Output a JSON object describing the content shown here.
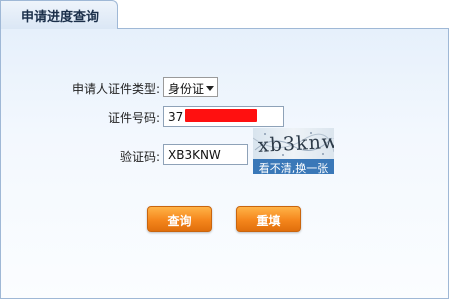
{
  "tab": {
    "title": "申请进度查询"
  },
  "form": {
    "id_type_label": "申请人证件类型:",
    "id_type_value": "身份证",
    "id_number_label": "证件号码:",
    "id_number_value": "37",
    "captcha_label": "验证码:",
    "captcha_value": "XB3KNW",
    "captcha_image_text": "xb3knw",
    "captcha_refresh": "看不清,换一张"
  },
  "buttons": {
    "query": "查询",
    "reset": "重填"
  },
  "colors": {
    "button_orange": "#f5861c",
    "redaction": "#ff1010",
    "captcha_strip": "#3a78b8",
    "panel_border": "#9fb8d6"
  }
}
